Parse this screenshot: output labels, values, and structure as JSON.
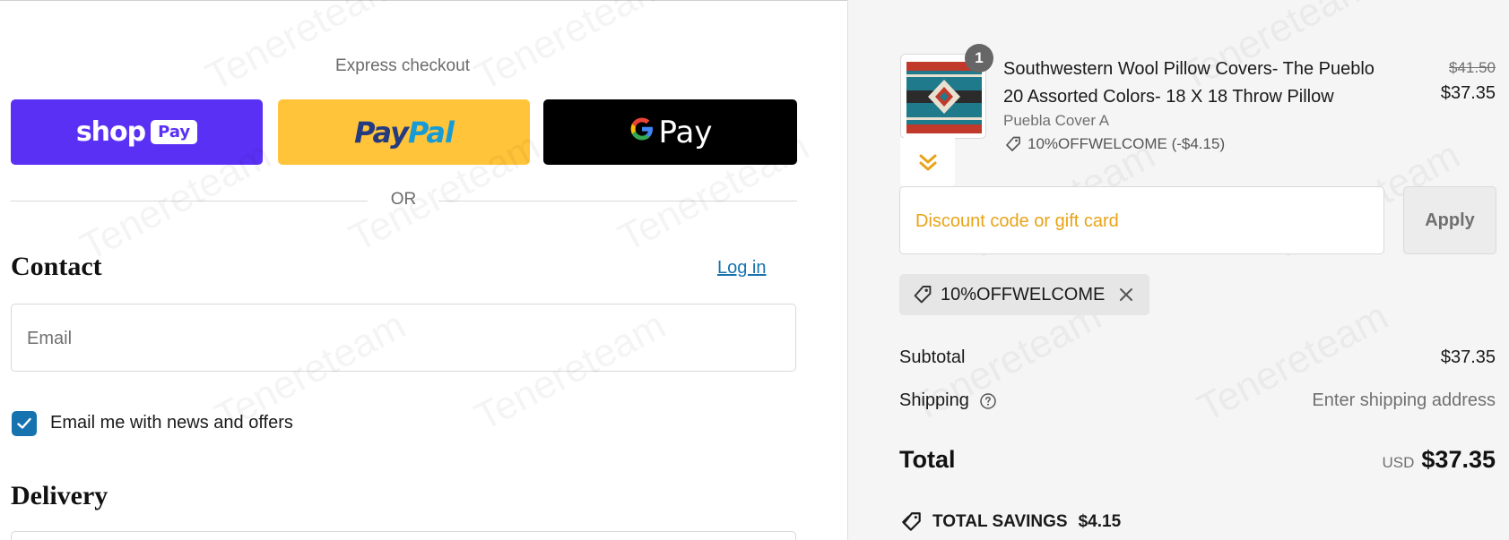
{
  "express": {
    "title": "Express checkout",
    "shop_pay_word": "shop",
    "shop_pay_badge": "Pay",
    "paypal_pay": "Pay",
    "paypal_pal": "Pal",
    "gpay_text": "Pay",
    "or_text": "OR"
  },
  "contact": {
    "heading": "Contact",
    "login_link": "Log in",
    "email_placeholder": "Email",
    "newsletter_label": "Email me with news and offers",
    "newsletter_checked": true
  },
  "delivery": {
    "heading": "Delivery"
  },
  "cart": {
    "item": {
      "quantity": "1",
      "title": "Southwestern Wool Pillow Covers- The Pueblo 20 Assorted Colors- 18 X 18 Throw Pillow",
      "variant": "Puebla Cover A",
      "discount": "10%OFFWELCOME (-$4.15)",
      "original_price": "$41.50",
      "price": "$37.35"
    },
    "discount_placeholder": "Discount code or gift card",
    "apply_label": "Apply",
    "applied_code": "10%OFFWELCOME",
    "subtotal_label": "Subtotal",
    "subtotal_value": "$37.35",
    "shipping_label": "Shipping",
    "shipping_value": "Enter shipping address",
    "total_label": "Total",
    "total_currency": "USD",
    "total_value": "$37.35",
    "savings_label": "TOTAL SAVINGS",
    "savings_value": "$4.15"
  },
  "watermark": "Tenereteam",
  "colors": {
    "shop_pay": "#5a31f4",
    "paypal": "#ffc439",
    "gpay": "#000000",
    "link": "#1773b0",
    "checkbox": "#1773b0"
  }
}
